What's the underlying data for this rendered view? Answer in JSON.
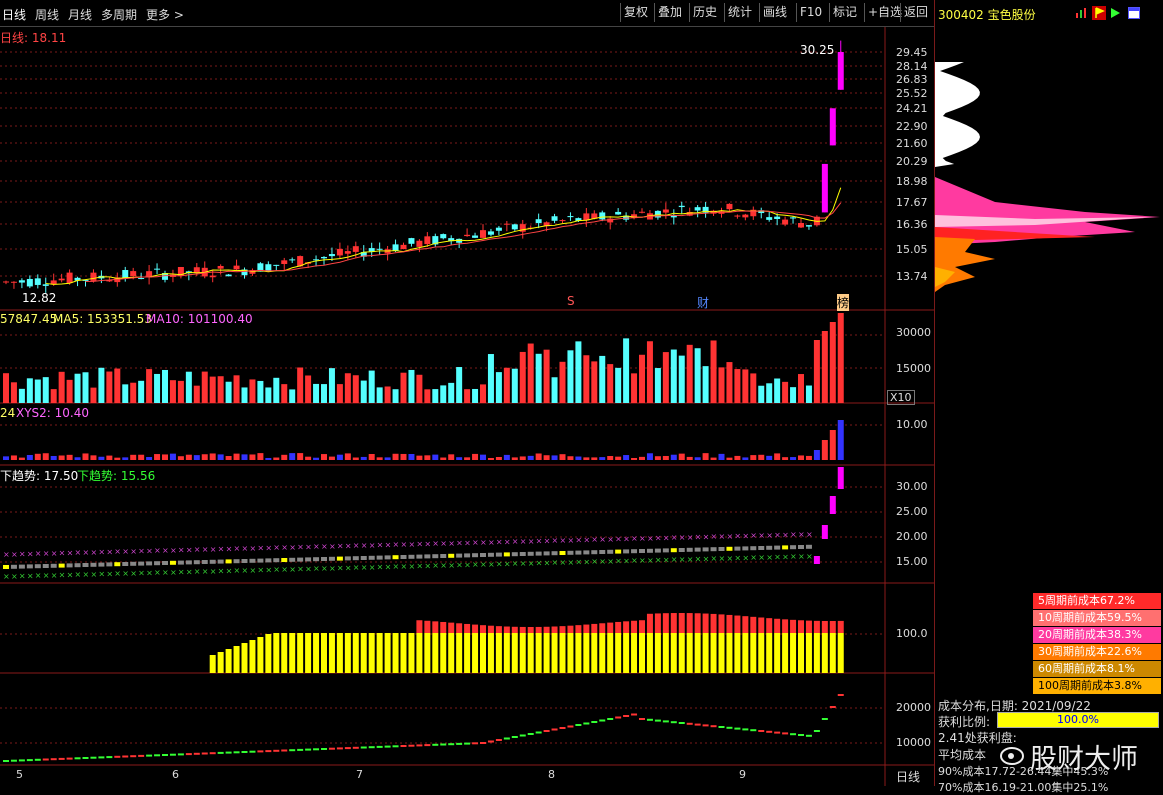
{
  "toolbar": {
    "periods": [
      "日线",
      "周线",
      "月线",
      "多周期",
      "更多 >"
    ],
    "buttons": [
      "复权",
      "叠加",
      "历史",
      "统计",
      "画线",
      "F10",
      "标记",
      "+自选",
      "返回"
    ]
  },
  "stock": {
    "code_name": "300402 宝色股份"
  },
  "main_chart": {
    "ma_label": "日线: 18.11",
    "high_label": "30.25",
    "low_label": "12.82",
    "markers": [
      "S",
      "财",
      "榜"
    ],
    "y_ticks": [
      "29.45",
      "28.14",
      "26.83",
      "25.52",
      "24.21",
      "22.90",
      "21.60",
      "20.29",
      "18.98",
      "17.67",
      "16.36",
      "15.05",
      "13.74"
    ]
  },
  "volume_panel": {
    "label_a": "57847.45",
    "label_ma5": "MA5: 153351.53",
    "label_ma10": "MA10: 101100.40",
    "y_ticks": [
      "30000",
      "15000"
    ],
    "unit": "X10"
  },
  "xys_panel": {
    "label_a": "24",
    "label_b": "XYS2: 10.40",
    "y_ticks": [
      "10.00"
    ]
  },
  "trend_panel": {
    "label_a": "下趋势: 17.50",
    "label_b": "下趋势: 15.56",
    "y_ticks": [
      "30.00",
      "25.00",
      "20.00",
      "15.00"
    ]
  },
  "cost_bar_panel": {
    "y_ticks": [
      "100.0"
    ]
  },
  "bottom_panel": {
    "y_ticks": [
      "20000",
      "10000"
    ]
  },
  "x_axis": {
    "labels": [
      "5",
      "6",
      "7",
      "8",
      "9"
    ],
    "period_label": "日线"
  },
  "cost_distribution": {
    "legend": [
      {
        "text": "5周期前成本67.2%",
        "bg": "#ff2a2a",
        "fg": "#ffffff"
      },
      {
        "text": "10周期前成本59.5%",
        "bg": "#ff7070",
        "fg": "#ffffff"
      },
      {
        "text": "20周期前成本38.3%",
        "bg": "#ff3aa0",
        "fg": "#ffffff"
      },
      {
        "text": "30周期前成本22.6%",
        "bg": "#ff7a00",
        "fg": "#ffffff"
      },
      {
        "text": "60周期前成本8.1%",
        "bg": "#cc8800",
        "fg": "#ffffff"
      },
      {
        "text": "100周期前成本3.8%",
        "bg": "#ffb000",
        "fg": "#000000"
      }
    ],
    "info_title": "成本分布,日期: 2021/09/22",
    "profit_label": "获利比例:",
    "profit_value": "100.0%",
    "profit_at": "2.41处获利盘:",
    "avg_cost": "平均成本",
    "cost90": "90%成本17.72-26.44集中45.3%",
    "cost70": "70%成本16.19-21.00集中25.1%",
    "watermark": "股财大师"
  },
  "colors": {
    "up": "#ff3333",
    "down": "#55ffff",
    "magenta": "#ff00ff",
    "yellow": "#ffff00",
    "grid": "#7a1a1a"
  }
}
